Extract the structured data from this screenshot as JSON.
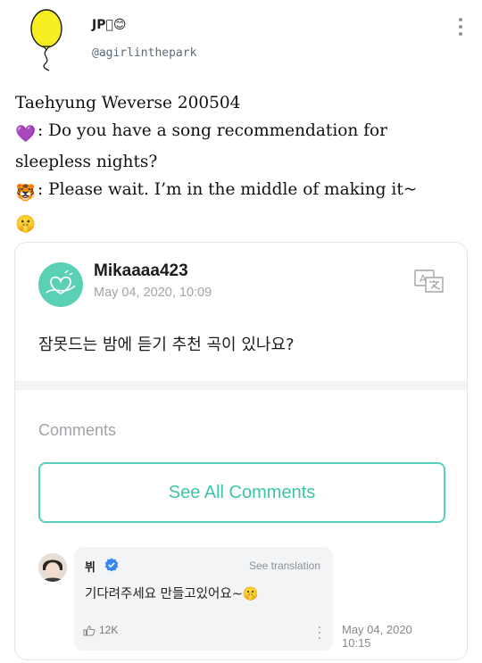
{
  "tweet": {
    "display_name": "JP⃝😊",
    "handle": "@agirlinthepark",
    "avatar_icon": "yellow-balloon",
    "lines": {
      "l1": "Taehyung Weverse 200504",
      "l2": ": Do you have a song recommendation for",
      "l3": "sleepless nights?",
      "l4": ": Please wait. I’m in the middle of making it~",
      "l2_emoji": "💜",
      "l4_emoji": "🐯",
      "l5_emoji": "🤫"
    }
  },
  "post": {
    "author": "Mikaaaa423",
    "date": "May 04, 2020, 10:09",
    "body": "잠못드는 밤에 듣기 추천 곡이 있나요?",
    "translate_icon": "translate-icon",
    "comments_label": "Comments",
    "see_all_label": "See All Comments",
    "colors": {
      "accent": "#56d1b8",
      "avatar": "#5ad0b5"
    }
  },
  "comment": {
    "name": "뷔",
    "see_translation": "See translation",
    "text": "기다려주세요 만들고있어요~🤫",
    "likes": "12K",
    "time_line1": "May 04, 2020",
    "time_line2": "10:15"
  }
}
